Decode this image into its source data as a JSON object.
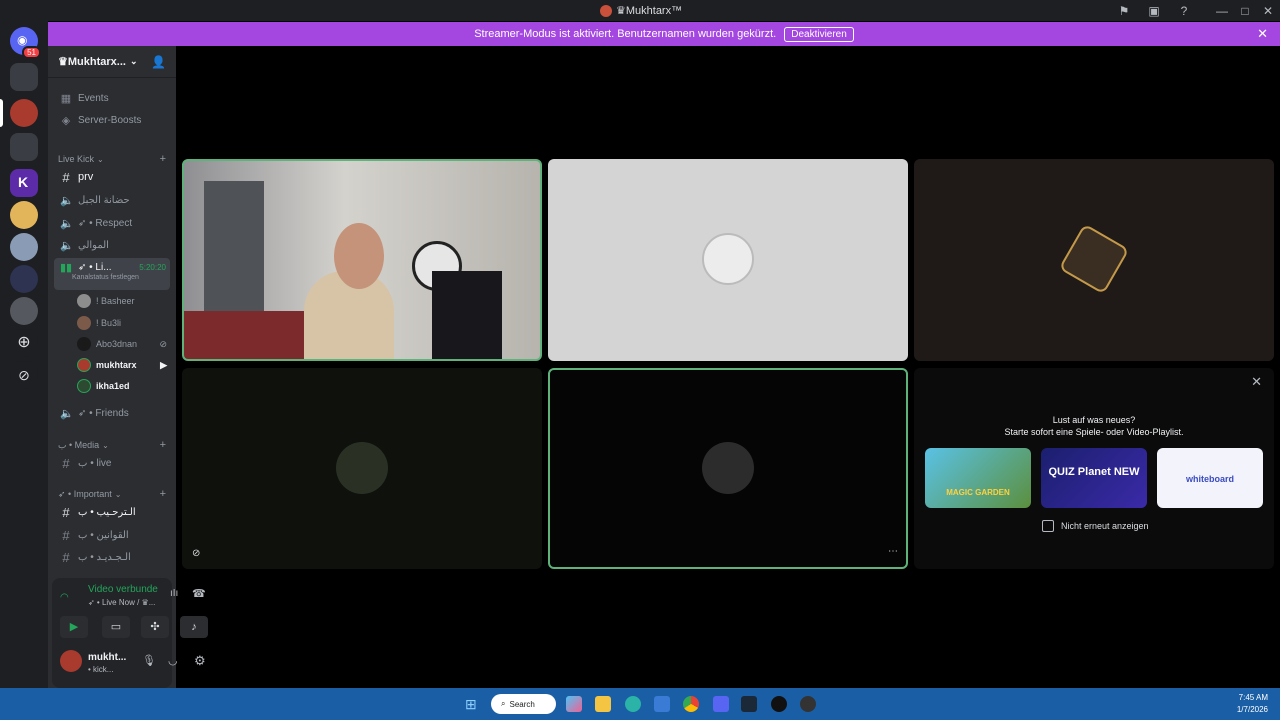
{
  "window": {
    "title": "♛Mukhtarx™"
  },
  "banner": {
    "text": "Streamer-Modus ist aktiviert. Benutzernamen wurden gekürzt.",
    "button": "Deaktivieren"
  },
  "guilds": {
    "discord_badge": "51"
  },
  "server": {
    "name": "♛Mukhtarx..."
  },
  "nav": {
    "events": "Events",
    "boosts": "Server-Boosts"
  },
  "categories": {
    "live_kick": "Live Kick",
    "media": "ب • Media",
    "important": "➶ • Important"
  },
  "channels": {
    "prv": "prv",
    "ch2": "حضانة الجبل",
    "respect": "➶ • Respect",
    "ch4": "الموالي",
    "live": "➶ • Li...",
    "live_time": "5:20:20",
    "live_status": "Kanalstatus festlegen",
    "friends": "➶ • Friends",
    "media_live": "ب • live",
    "imp1": "الـترحـيب • ب",
    "imp2": "القوانين • ب",
    "imp3": "الـجـديـد • ب"
  },
  "voice_users": [
    "! Basheer",
    "! Bu3li",
    "Abo3dnan",
    "mukhtarx",
    "ikha1ed"
  ],
  "voice_panel": {
    "status": "Video verbunde",
    "sub": "➶ • Live Now / ♛..."
  },
  "user": {
    "name": "mukht...",
    "sub": "• kick..."
  },
  "promo": {
    "line1": "Lust auf was neues?",
    "line2": "Starte sofort eine Spiele- oder Video-Playlist.",
    "cards": [
      "MAGIC GARDEN",
      "QUIZ Planet NEW",
      "whiteboard"
    ],
    "checkbox": "Nicht erneut anzeigen"
  },
  "taskbar": {
    "search": "Search",
    "time": "7:45 AM",
    "date": "1/7/2026"
  },
  "colors": {
    "banner": "#a347e0",
    "speaking": "#5fb37a",
    "taskbar": "#1a5fa5"
  }
}
